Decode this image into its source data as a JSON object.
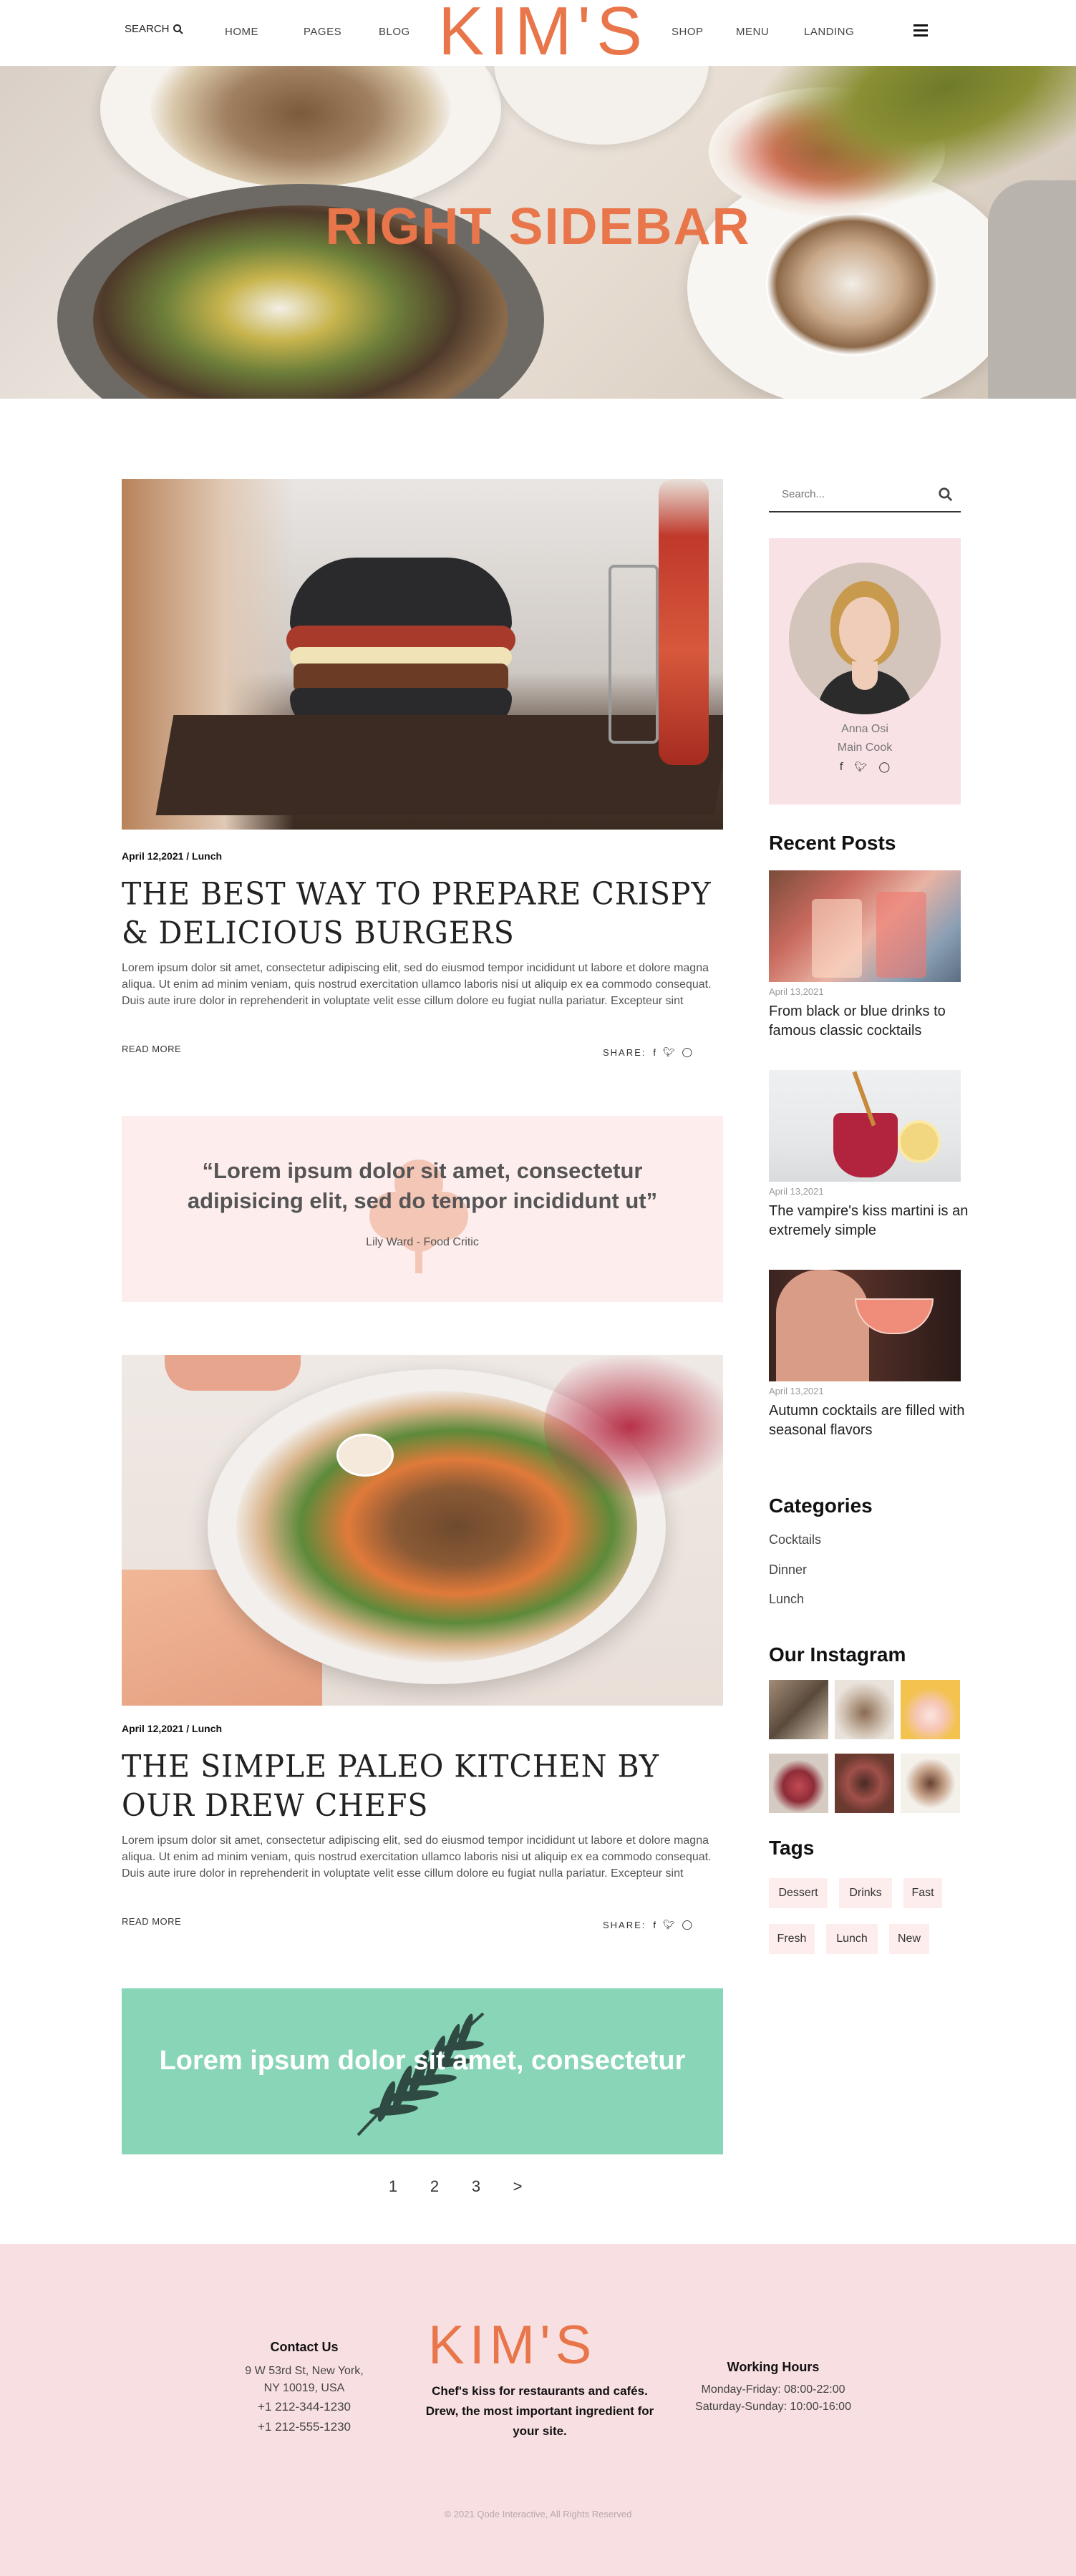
{
  "header": {
    "search_label": "SEARCH",
    "nav_left": [
      "HOME",
      "PAGES",
      "BLOG"
    ],
    "logo": "KIM'S",
    "nav_right": [
      "SHOP",
      "MENU",
      "LANDING"
    ]
  },
  "hero": {
    "title": "RIGHT SIDEBAR"
  },
  "posts": [
    {
      "meta": "April 12,2021 / Lunch",
      "title": "THE BEST WAY TO PREPARE CRISPY & DELICIOUS BURGERS",
      "excerpt": "Lorem ipsum dolor sit amet, consectetur adipiscing elit, sed do eiusmod tempor incididunt ut labore et dolore magna aliqua. Ut enim ad minim veniam, quis nostrud exercitation ullamco laboris nisi ut aliquip ex ea commodo consequat. Duis aute irure dolor in reprehenderit in voluptate velit esse cillum dolore eu fugiat nulla pariatur. Excepteur sint",
      "read_more": "READ MORE",
      "share": "SHARE:"
    },
    {
      "meta": "April 12,2021 / Lunch",
      "title": "THE SIMPLE PALEO KITCHEN BY OUR DREW CHEFS",
      "excerpt": "Lorem ipsum dolor sit amet, consectetur adipiscing elit, sed do eiusmod tempor incididunt ut labore et dolore magna aliqua. Ut enim ad minim veniam, quis nostrud exercitation ullamco laboris nisi ut aliquip ex ea commodo consequat. Duis aute irure dolor in reprehenderit in voluptate velit esse cillum dolore eu fugiat nulla pariatur. Excepteur sint",
      "read_more": "READ MORE",
      "share": "SHARE:"
    }
  ],
  "quote": {
    "text": "“Lorem ipsum dolor sit amet, consectetur adipisicing elit, sed do tempor incididunt ut”",
    "author": "Lily Ward - Food Critic"
  },
  "link_post": {
    "text": "Lorem ipsum dolor sit amet, consectetur"
  },
  "pagination": [
    "1",
    "2",
    "3",
    ">"
  ],
  "sidebar": {
    "search_placeholder": "Search...",
    "author": {
      "name": "Anna Osi",
      "role": "Main Cook"
    },
    "recent_heading": "Recent Posts",
    "recent_posts": [
      {
        "date": "April 13,2021",
        "title": "From black or blue drinks to famous classic cocktails"
      },
      {
        "date": "April 13,2021",
        "title": "The vampire's kiss martini is an extremely simple"
      },
      {
        "date": "April 13,2021",
        "title": "Autumn cocktails are filled with seasonal flavors"
      }
    ],
    "categories_heading": "Categories",
    "categories": [
      "Cocktails",
      "Dinner",
      "Lunch"
    ],
    "instagram_heading": "Our Instagram",
    "tags_heading": "Tags",
    "tags": [
      "Dessert",
      "Drinks",
      "Fast",
      "Fresh",
      "Lunch",
      "New"
    ]
  },
  "footer": {
    "contact_heading": "Contact Us",
    "contact_lines": [
      "9 W 53rd St, New York,",
      "NY 10019, USA",
      "+1 212-344-1230",
      "+1 212-555-1230"
    ],
    "logo": "KIM'S",
    "tagline": "Chef's kiss for restaurants and cafés. Drew, the most important ingredient for your site.",
    "hours_heading": "Working Hours",
    "hours_lines": [
      "Monday-Friday: 08:00-22:00",
      "Saturday-Sunday: 10:00-16:00"
    ],
    "copyright": "© 2021 Qode Interactive, All Rights Reserved"
  },
  "colors": {
    "accent": "#e8764a",
    "pink_bg": "#f8dfe2",
    "quote_bg": "#fdeeed",
    "mint": "#88d6b7"
  }
}
